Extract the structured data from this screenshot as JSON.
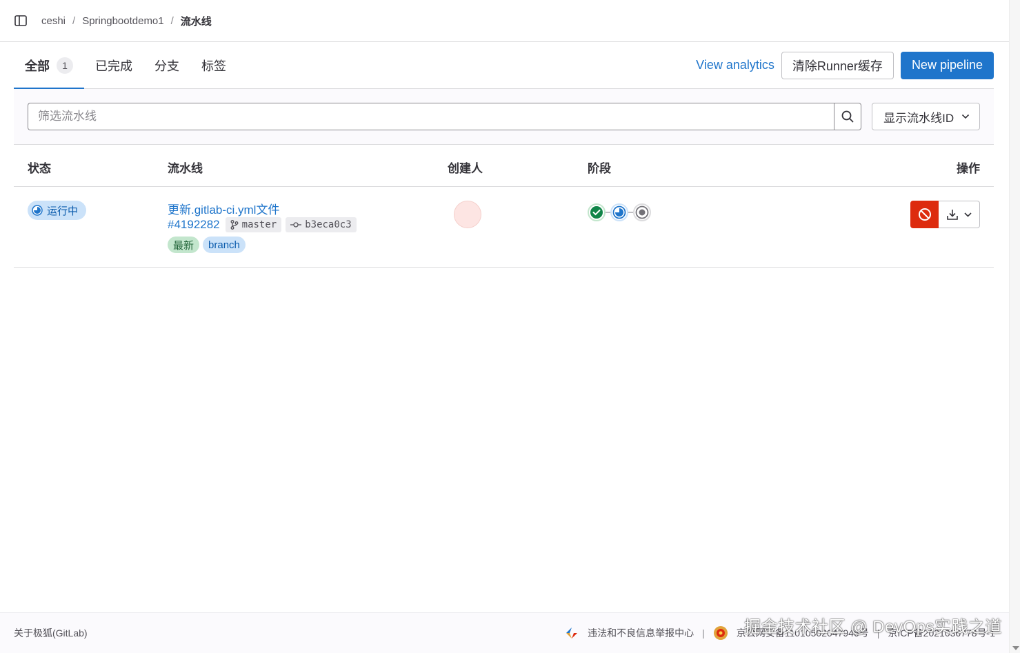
{
  "breadcrumb": {
    "items": [
      "ceshi",
      "Springbootdemo1"
    ],
    "current": "流水线",
    "separator": "/"
  },
  "tabs": [
    {
      "label": "全部",
      "count": "1"
    },
    {
      "label": "已完成"
    },
    {
      "label": "分支"
    },
    {
      "label": "标签"
    }
  ],
  "header_actions": {
    "view_analytics": "View analytics",
    "clear_cache": "清除Runner缓存",
    "new_pipeline": "New pipeline"
  },
  "filter": {
    "placeholder": "筛选流水线",
    "display_select": "显示流水线ID"
  },
  "table": {
    "headers": {
      "status": "状态",
      "pipeline": "流水线",
      "creator": "创建人",
      "stages": "阶段",
      "actions": "操作"
    },
    "rows": [
      {
        "status": "运行中",
        "title": "更新.gitlab-ci.yml文件",
        "id": "#4192282",
        "branch": "master",
        "commit": "b3eca0c3",
        "tags": [
          "最新",
          "branch"
        ],
        "stages": [
          "success",
          "running",
          "pending"
        ]
      }
    ]
  },
  "footer": {
    "about": "关于极狐(GitLab)",
    "report": "违法和不良信息举报中心",
    "police": "京公网安备11010502047946号",
    "icp": "京ICP备2021036778号-1"
  },
  "watermark": "掘金技术社区 @ DevOps实践之道",
  "colors": {
    "accent": "#1f75cb",
    "danger": "#dd2b0e",
    "success": "#108548"
  }
}
